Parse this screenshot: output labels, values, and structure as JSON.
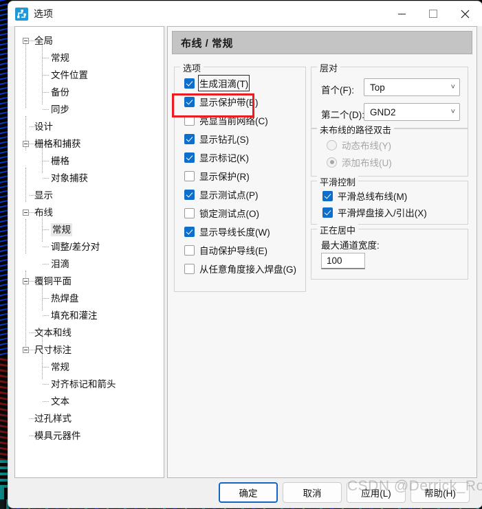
{
  "window": {
    "title": "选项",
    "icon": "pcb-route-icon",
    "minimize_label": "最小化",
    "maximize_label": "最大化",
    "close_label": "关闭"
  },
  "tree": {
    "items": [
      {
        "label": "全局",
        "level": 0,
        "expander": "minus",
        "selected": false
      },
      {
        "label": "常规",
        "level": 1,
        "expander": "none",
        "selected": false
      },
      {
        "label": "文件位置",
        "level": 1,
        "expander": "none",
        "selected": false
      },
      {
        "label": "备份",
        "level": 1,
        "expander": "none",
        "selected": false
      },
      {
        "label": "同步",
        "level": 1,
        "expander": "none",
        "selected": false
      },
      {
        "label": "设计",
        "level": 0,
        "expander": "none",
        "selected": false
      },
      {
        "label": "栅格和捕获",
        "level": 0,
        "expander": "minus",
        "selected": false
      },
      {
        "label": "栅格",
        "level": 1,
        "expander": "none",
        "selected": false
      },
      {
        "label": "对象捕获",
        "level": 1,
        "expander": "none",
        "selected": false
      },
      {
        "label": "显示",
        "level": 0,
        "expander": "none",
        "selected": false
      },
      {
        "label": "布线",
        "level": 0,
        "expander": "minus",
        "selected": false
      },
      {
        "label": "常规",
        "level": 1,
        "expander": "none",
        "selected": true
      },
      {
        "label": "调整/差分对",
        "level": 1,
        "expander": "none",
        "selected": false
      },
      {
        "label": "泪滴",
        "level": 1,
        "expander": "none",
        "selected": false
      },
      {
        "label": "覆铜平面",
        "level": 0,
        "expander": "minus",
        "selected": false
      },
      {
        "label": "热焊盘",
        "level": 1,
        "expander": "none",
        "selected": false
      },
      {
        "label": "填充和灌注",
        "level": 1,
        "expander": "none",
        "selected": false
      },
      {
        "label": "文本和线",
        "level": 0,
        "expander": "none",
        "selected": false
      },
      {
        "label": "尺寸标注",
        "level": 0,
        "expander": "minus",
        "selected": false
      },
      {
        "label": "常规",
        "level": 1,
        "expander": "none",
        "selected": false
      },
      {
        "label": "对齐标记和箭头",
        "level": 1,
        "expander": "none",
        "selected": false
      },
      {
        "label": "文本",
        "level": 1,
        "expander": "none",
        "selected": false
      },
      {
        "label": "过孔样式",
        "level": 0,
        "expander": "none",
        "selected": false
      },
      {
        "label": "模具元器件",
        "level": 0,
        "expander": "none",
        "selected": false
      }
    ]
  },
  "page": {
    "header": "布线 / 常规"
  },
  "options_group": {
    "title": "选项",
    "checkboxes": [
      {
        "label": "生成泪滴(T)",
        "checked": true,
        "focused": true
      },
      {
        "label": "显示保护带(B)",
        "checked": true,
        "focused": false
      },
      {
        "label": "亮显当前网络(C)",
        "checked": false,
        "focused": false
      },
      {
        "label": "显示钻孔(S)",
        "checked": true,
        "focused": false
      },
      {
        "label": "显示标记(K)",
        "checked": true,
        "focused": false
      },
      {
        "label": "显示保护(R)",
        "checked": false,
        "focused": false
      },
      {
        "label": "显示测试点(P)",
        "checked": true,
        "focused": false
      },
      {
        "label": "锁定测试点(O)",
        "checked": false,
        "focused": false
      },
      {
        "label": "显示导线长度(W)",
        "checked": true,
        "focused": false
      },
      {
        "label": "自动保护导线(E)",
        "checked": false,
        "focused": false
      },
      {
        "label": "从任意角度接入焊盘(G)",
        "checked": false,
        "focused": false
      }
    ]
  },
  "layer_pair_group": {
    "title": "层对",
    "first_label": "首个(F):",
    "first_value": "Top",
    "second_label": "第二个(D):",
    "second_value": "GND2"
  },
  "unrouted_group": {
    "title": "未布线的路径双击",
    "radios": [
      {
        "label": "动态布线(Y)",
        "selected": false,
        "disabled": true
      },
      {
        "label": "添加布线(U)",
        "selected": true,
        "disabled": true
      }
    ]
  },
  "smoothing_group": {
    "title": "平滑控制",
    "checkboxes": [
      {
        "label": "平滑总线布线(M)",
        "checked": true
      },
      {
        "label": "平滑焊盘接入/引出(X)",
        "checked": true
      }
    ]
  },
  "centering_group": {
    "title": "正在居中",
    "field_label": "最大通道宽度:",
    "field_value": "100"
  },
  "footer": {
    "ok": "确定",
    "cancel": "取消",
    "apply": "应用(L)",
    "help": "帮助(H)"
  },
  "watermark": "CSDN @Derrick_Rose",
  "colors": {
    "accent": "#0d6ecb",
    "annotation": "#ec1c24",
    "header_bg": "#c4c4c4"
  }
}
